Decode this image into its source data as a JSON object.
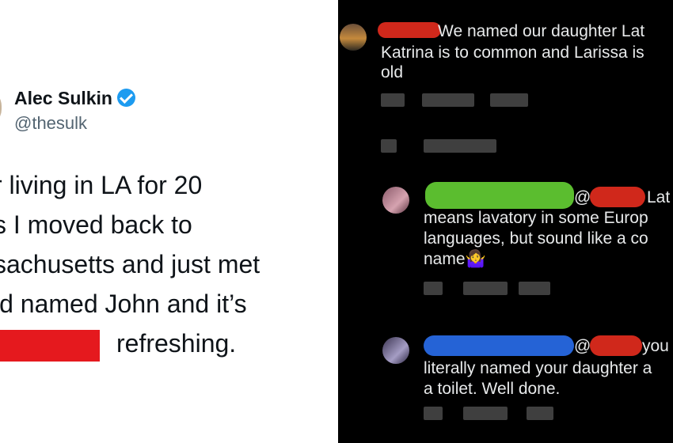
{
  "tweet": {
    "author_name": "Alec Sulkin",
    "author_handle": "@thesulk",
    "lines": [
      "r living in LA for 20",
      "s I moved back to",
      "sachusetts and just met",
      "ld named John and it’s",
      "refreshing."
    ],
    "colors": {
      "redaction": "#e5191e",
      "verified": "#1d9bf0"
    }
  },
  "comments": [
    {
      "lines": [
        "We named our daughter Lat",
        "Katrina is to common and Larissa is",
        "old"
      ]
    },
    {
      "lines": [
        "@",
        "Lat",
        "means lavatory in some Europ",
        "languages, but sound like a co",
        "name🤷‍♀️"
      ]
    },
    {
      "lines": [
        "@",
        "you",
        "literally named your daughter a",
        "a toilet. Well done."
      ]
    }
  ],
  "icons": [
    "verified-badge-icon",
    "shrug-emoji-icon"
  ]
}
